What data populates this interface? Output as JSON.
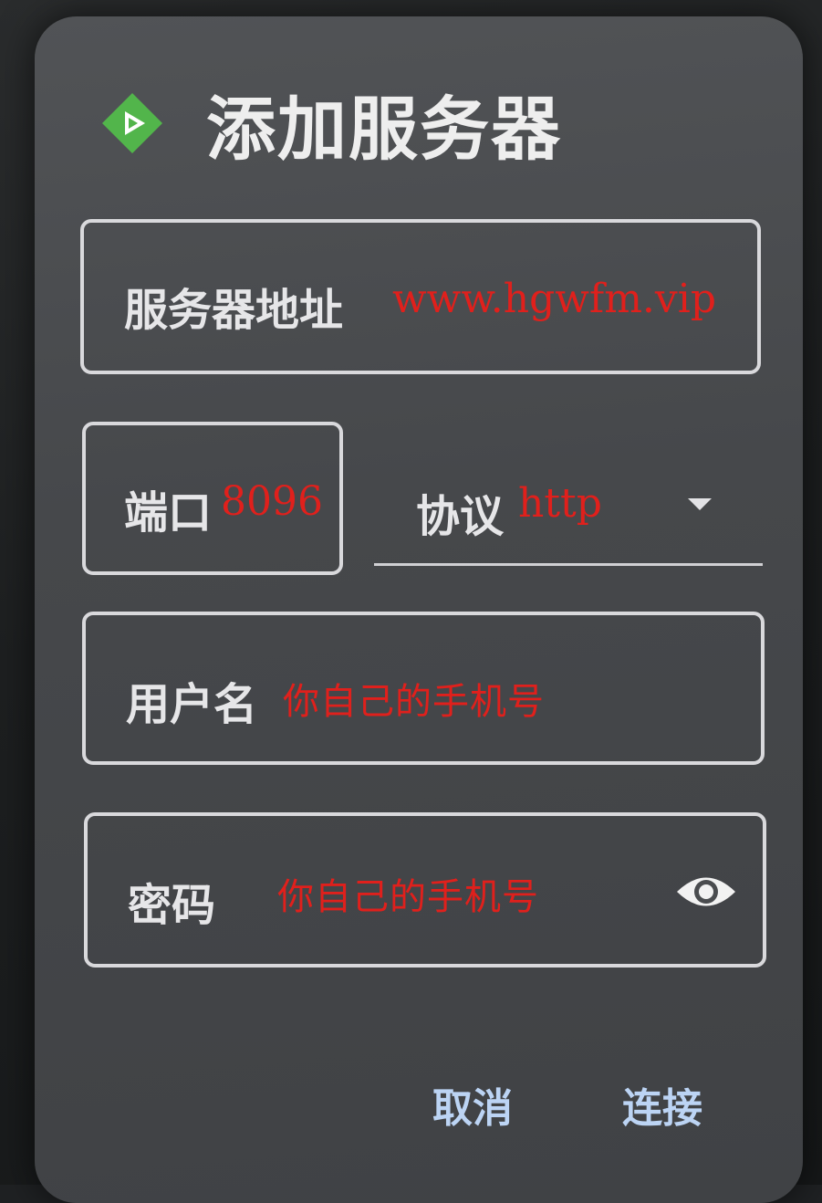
{
  "dialog": {
    "title": "添加服务器",
    "logo_icon": "emby-play-icon",
    "accent_color": "#52b54b"
  },
  "fields": {
    "server_address": {
      "label": "服务器地址",
      "value": "www.hgwfm.vip"
    },
    "port": {
      "label": "端口",
      "value": "8096"
    },
    "protocol": {
      "label": "协议",
      "value": "http",
      "icon": "dropdown-caret-icon"
    },
    "username": {
      "label": "用户名",
      "value": "你自己的手机号"
    },
    "password": {
      "label": "密码",
      "value": "你自己的手机号",
      "icon": "eye-icon"
    }
  },
  "actions": {
    "cancel_label": "取消",
    "connect_label": "连接"
  },
  "colors": {
    "annotation": "#e0201c",
    "action_text": "#bcd4f4",
    "field_border": "#d9d9dc",
    "dialog_bg": "#4a4c4f"
  }
}
